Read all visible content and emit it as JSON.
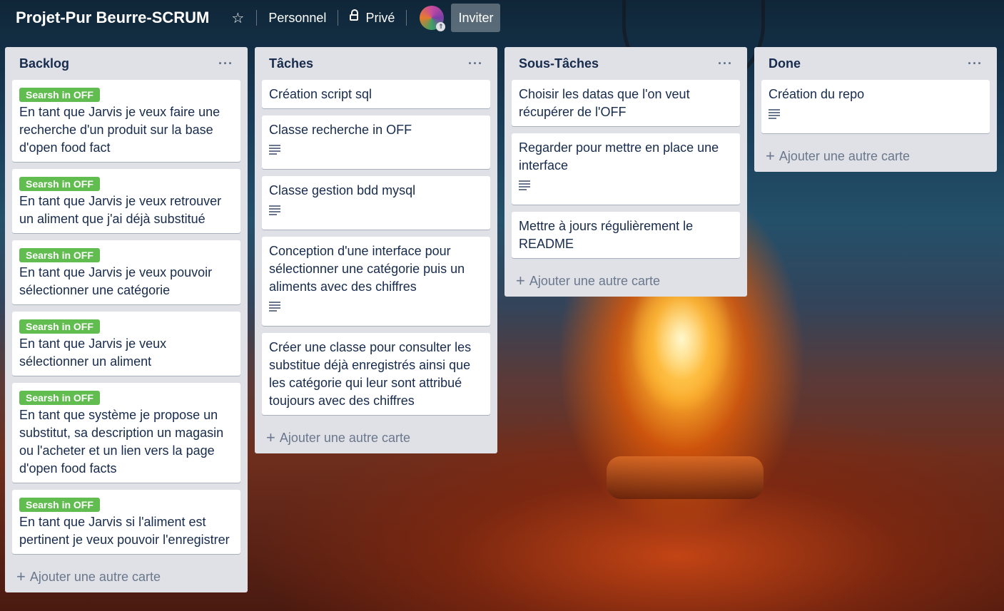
{
  "header": {
    "board_title": "Projet-Pur Beurre-SCRUM",
    "star_icon": "star-icon",
    "team_label": "Personnel",
    "visibility_label": "Privé",
    "invite_label": "Inviter"
  },
  "label_color": "#61bd4f",
  "add_card_label": "Ajouter une autre carte",
  "lists": [
    {
      "title": "Backlog",
      "cards": [
        {
          "label": "Searsh in OFF",
          "text": "En tant que Jarvis je veux faire une recherche d'un produit sur la base d'open food fact"
        },
        {
          "label": "Searsh in OFF",
          "text": "En tant que Jarvis je veux retrouver un aliment que j'ai déjà substitué"
        },
        {
          "label": "Searsh in OFF",
          "text": "En tant que Jarvis je veux pouvoir sélectionner une catégorie"
        },
        {
          "label": "Searsh in OFF",
          "text": "En tant que Jarvis je veux sélectionner un aliment"
        },
        {
          "label": "Searsh in OFF",
          "text": "En tant que système je propose un substitut, sa description un magasin ou l'acheter et un lien vers la page d'open food facts"
        },
        {
          "label": "Searsh in OFF",
          "text": "En tant que Jarvis si l'aliment est pertinent je veux pouvoir l'enregistrer"
        }
      ]
    },
    {
      "title": "Tâches",
      "cards": [
        {
          "text": "Création script sql"
        },
        {
          "text": "Classe recherche in OFF"
        },
        {
          "text": "Classe gestion bdd mysql"
        },
        {
          "text": "Conception d'une interface pour sélectionner une catégorie puis un aliments avec des chiffres"
        },
        {
          "text": "Créer une classe pour consulter les substitue déjà enregistrés ainsi que les catégorie qui leur sont attribué toujours avec des chiffres"
        }
      ]
    },
    {
      "title": "Sous-Tâches",
      "cards": [
        {
          "text": "Choisir les datas que l'on veut récupérer de l'OFF"
        },
        {
          "text": "Regarder pour mettre en place une interface"
        },
        {
          "text": "Mettre à jours régulièrement le README"
        }
      ]
    },
    {
      "title": "Done",
      "cards": [
        {
          "text": "Création du repo"
        }
      ]
    }
  ]
}
